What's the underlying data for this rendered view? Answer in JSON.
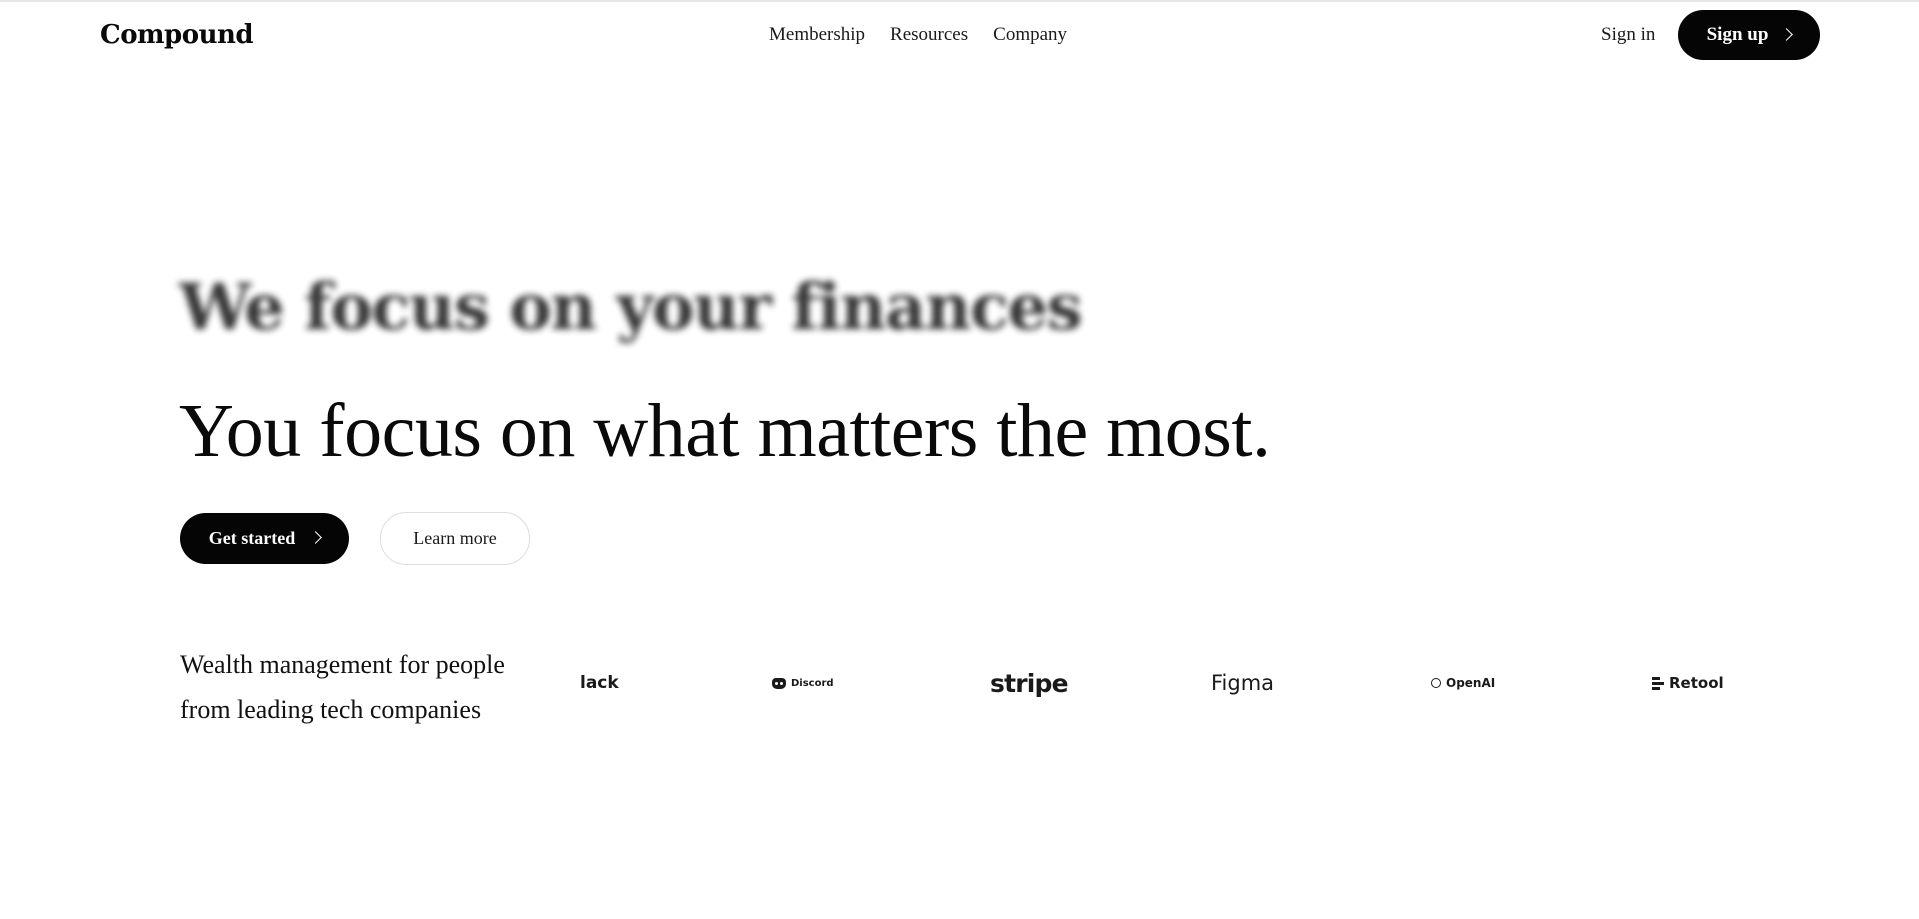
{
  "header": {
    "logo": "Compound",
    "nav": [
      "Membership",
      "Resources",
      "Company"
    ],
    "sign_in": "Sign in",
    "sign_up": "Sign up"
  },
  "hero": {
    "blurred_title": "We focus on your finances",
    "title": "You focus on what matters the most.",
    "primary_cta": "Get started",
    "secondary_cta": "Learn more"
  },
  "social_proof": {
    "tagline": "Wealth management for people from leading tech companies",
    "brands": {
      "slack": "lack",
      "discord": "Discord",
      "stripe": "stripe",
      "figma": "Figma",
      "openai": "OpenAI",
      "retool": "Retool"
    }
  },
  "icons": {
    "signup_chevron": "chevron-right-icon",
    "cta_chevron": "chevron-right-icon"
  }
}
